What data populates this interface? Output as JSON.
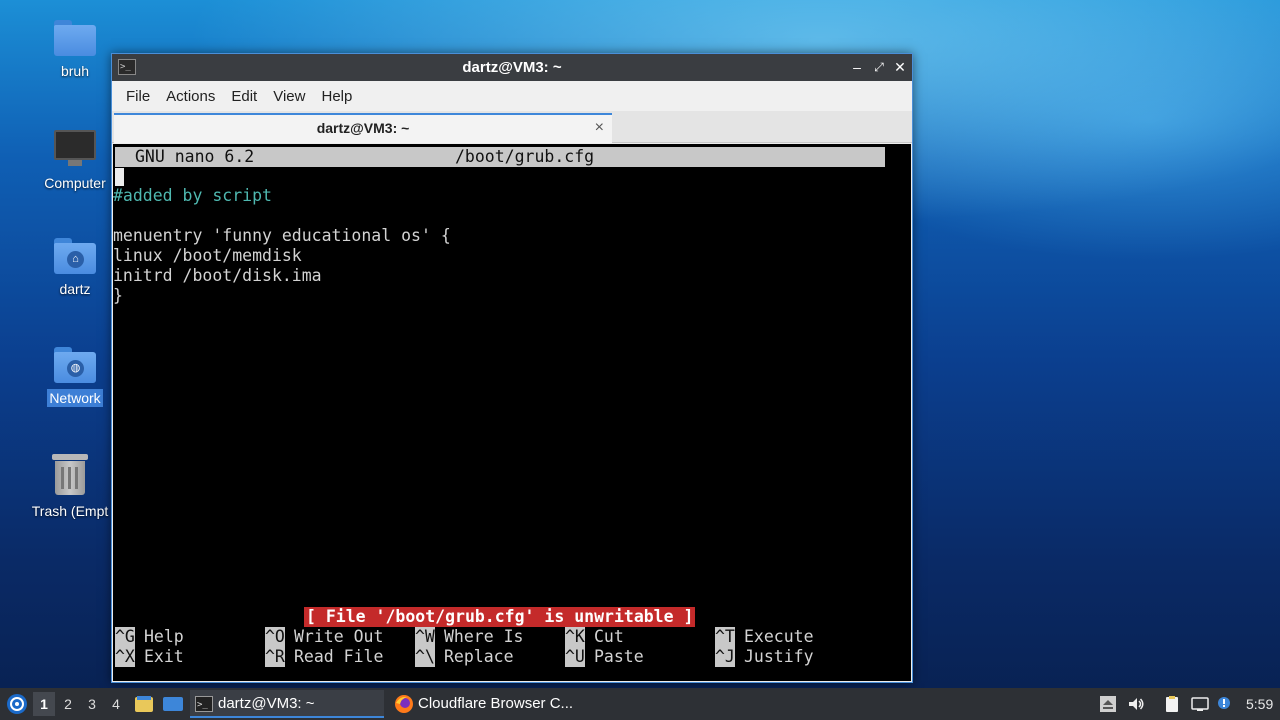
{
  "desktop": {
    "icons": [
      {
        "label": "bruh",
        "type": "folder"
      },
      {
        "label": "Computer",
        "type": "computer"
      },
      {
        "label": "dartz",
        "type": "home-folder"
      },
      {
        "label": "Network",
        "type": "network-folder",
        "selected": true
      },
      {
        "label": "Trash (Empt",
        "type": "trash"
      }
    ]
  },
  "window": {
    "title": "dartz@VM3: ~",
    "menu": [
      "File",
      "Actions",
      "Edit",
      "View",
      "Help"
    ],
    "tab_label": "dartz@VM3: ~",
    "tab_close": "×"
  },
  "nano": {
    "version": "GNU nano 6.2",
    "filename": "/boot/grub.cfg",
    "lines": [
      "",
      "#added by script",
      "",
      "menuentry 'funny educational os' {",
      "linux /boot/memdisk",
      "initrd /boot/disk.ima",
      "}"
    ],
    "status": "[ File '/boot/grub.cfg' is unwritable ]",
    "shortcuts": [
      [
        {
          "key": "^G",
          "label": "Help"
        },
        {
          "key": "^O",
          "label": "Write Out"
        },
        {
          "key": "^W",
          "label": "Where Is"
        },
        {
          "key": "^K",
          "label": "Cut"
        },
        {
          "key": "^T",
          "label": "Execute"
        }
      ],
      [
        {
          "key": "^X",
          "label": "Exit"
        },
        {
          "key": "^R",
          "label": "Read File"
        },
        {
          "key": "^\\",
          "label": "Replace"
        },
        {
          "key": "^U",
          "label": "Paste"
        },
        {
          "key": "^J",
          "label": "Justify"
        }
      ]
    ]
  },
  "taskbar": {
    "workspaces": [
      "1",
      "2",
      "3",
      "4"
    ],
    "active_workspace": "1",
    "tasks": [
      {
        "label": "dartz@VM3: ~",
        "icon": "terminal-icon",
        "active": true
      },
      {
        "label": "Cloudflare Browser C...",
        "icon": "firefox-icon",
        "active": false
      }
    ],
    "clock": "5:59"
  },
  "colors": {
    "accent": "#3d86d9",
    "titlebar": "#3a3d41",
    "status_bg": "#c42a2a",
    "comment": "#4fb8b0"
  }
}
